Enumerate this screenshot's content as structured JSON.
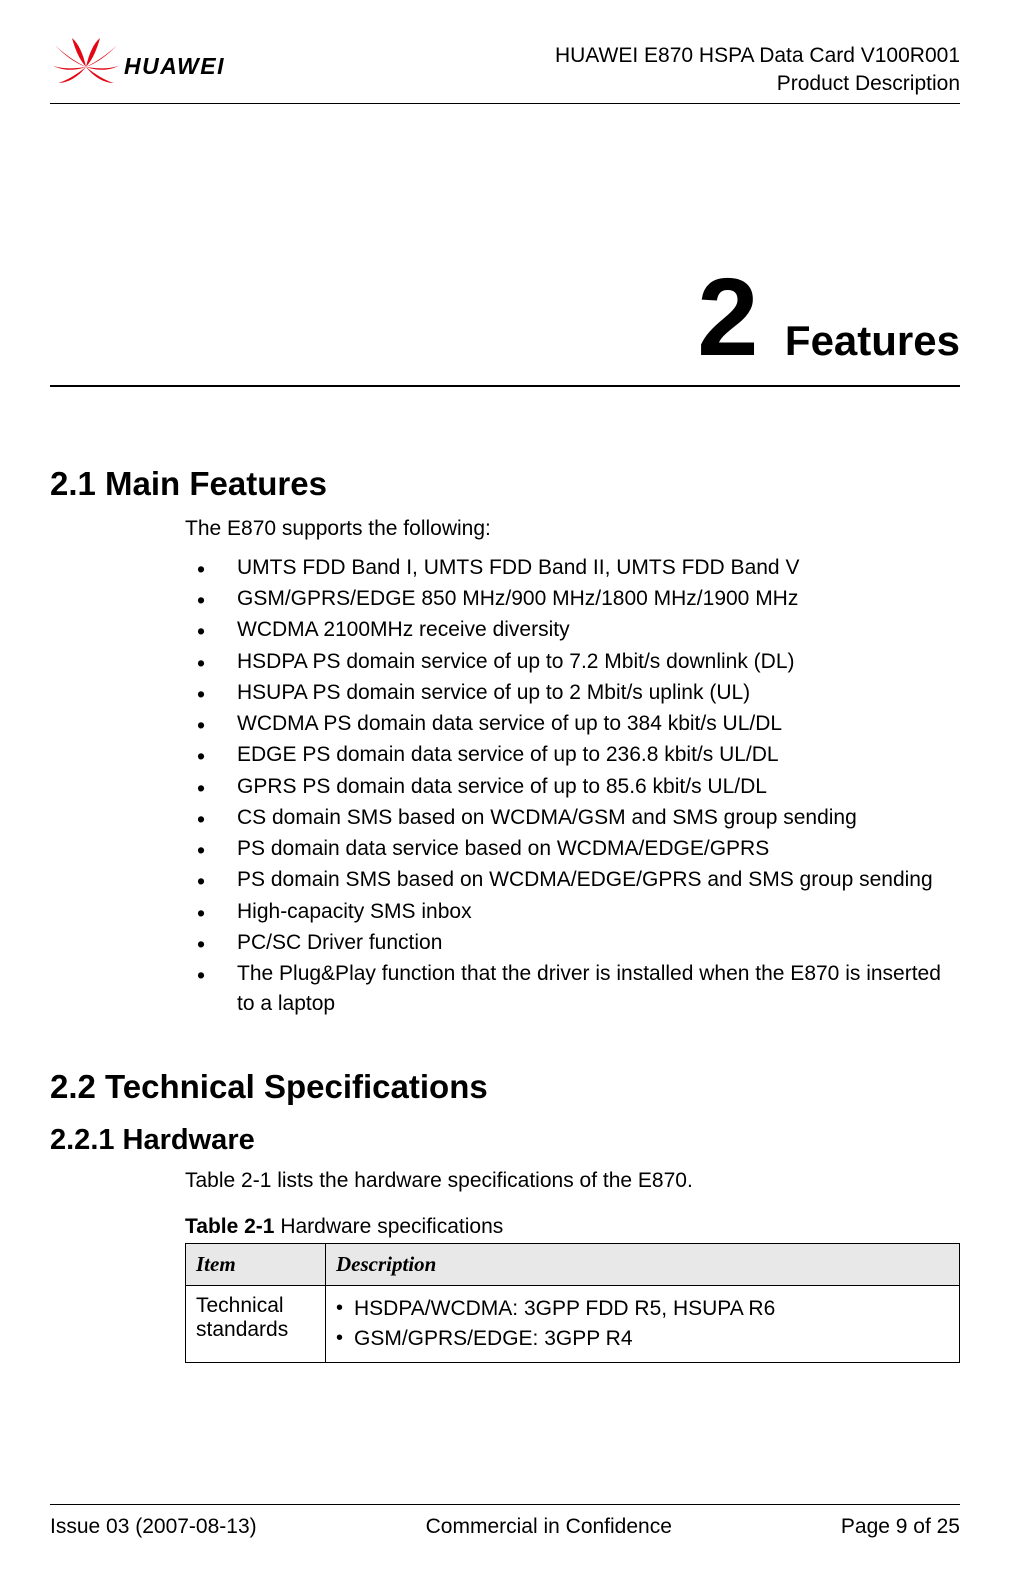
{
  "header": {
    "logo_text": "HUAWEI",
    "title_line1": "HUAWEI E870 HSPA Data Card V100R001",
    "title_line2": "Product Description"
  },
  "chapter": {
    "number": "2",
    "title": "Features"
  },
  "sections": {
    "main_features": {
      "heading": "2.1 Main Features",
      "intro": "The E870 supports the following:",
      "items": [
        "UMTS FDD Band I, UMTS FDD Band II, UMTS FDD Band V",
        "GSM/GPRS/EDGE 850 MHz/900 MHz/1800 MHz/1900 MHz",
        "WCDMA 2100MHz receive diversity",
        "HSDPA PS domain service of up to 7.2 Mbit/s downlink (DL)",
        "HSUPA PS domain service of up to 2 Mbit/s uplink (UL)",
        "WCDMA PS domain data service of up to 384 kbit/s UL/DL",
        "EDGE PS domain data service of up to 236.8 kbit/s UL/DL",
        "GPRS PS domain data service of up to 85.6 kbit/s UL/DL",
        "CS domain SMS based on WCDMA/GSM and SMS group sending",
        "PS domain data service based on WCDMA/EDGE/GPRS",
        "PS domain SMS based on WCDMA/EDGE/GPRS and SMS group sending",
        "High-capacity SMS inbox",
        "PC/SC Driver function",
        "The Plug&Play function that the driver is installed when the E870 is inserted to a laptop"
      ]
    },
    "tech_specs": {
      "heading": "2.2 Technical Specifications",
      "hardware": {
        "heading": "2.2.1 Hardware",
        "intro": "Table 2-1 lists the hardware specifications of the E870.",
        "table_caption_bold": "Table 2-1",
        "table_caption_rest": " Hardware specifications",
        "columns": {
          "item": "Item",
          "description": "Description"
        },
        "rows": [
          {
            "item": "Technical standards",
            "bullets": [
              "HSDPA/WCDMA: 3GPP FDD R5, HSUPA R6",
              "GSM/GPRS/EDGE: 3GPP R4"
            ]
          }
        ]
      }
    }
  },
  "footer": {
    "left": "Issue 03 (2007-08-13)",
    "center": "Commercial in Confidence",
    "right": "Page 9 of 25"
  }
}
